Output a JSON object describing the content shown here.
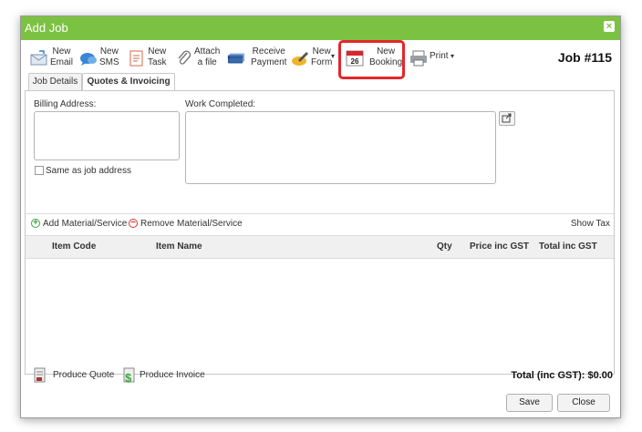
{
  "window": {
    "title": "Add Job",
    "close_glyph": "×"
  },
  "toolbar": {
    "new_email": [
      "New",
      "Email"
    ],
    "new_sms": [
      "New",
      "SMS"
    ],
    "new_task": [
      "New",
      "Task"
    ],
    "attach_file": [
      "Attach",
      "a file"
    ],
    "receive_payment": [
      "Receive",
      "Payment"
    ],
    "new_form": [
      "New",
      "Form"
    ],
    "new_booking": [
      "New",
      "Booking"
    ],
    "print": "Print",
    "calendar_day": "26",
    "job_number": "Job #115"
  },
  "tabs": [
    "Job Details",
    "Quotes & Invoicing"
  ],
  "form": {
    "billing_address_label": "Billing Address:",
    "work_completed_label": "Work Completed:",
    "same_as_job_label": "Same as job address"
  },
  "actions": {
    "add_material": "Add Material/Service",
    "remove_material": "Remove Material/Service",
    "show_tax": "Show Tax"
  },
  "table": {
    "columns": [
      "Item Code",
      "Item Name",
      "Qty",
      "Price inc GST",
      "Total inc GST"
    ]
  },
  "footer": {
    "produce_quote": "Produce Quote",
    "produce_invoice": "Produce Invoice",
    "total": "Total (inc GST): $0.00",
    "save": "Save",
    "close": "Close"
  },
  "colors": {
    "titlebar": "#7cc242",
    "highlight": "#e3262a"
  }
}
